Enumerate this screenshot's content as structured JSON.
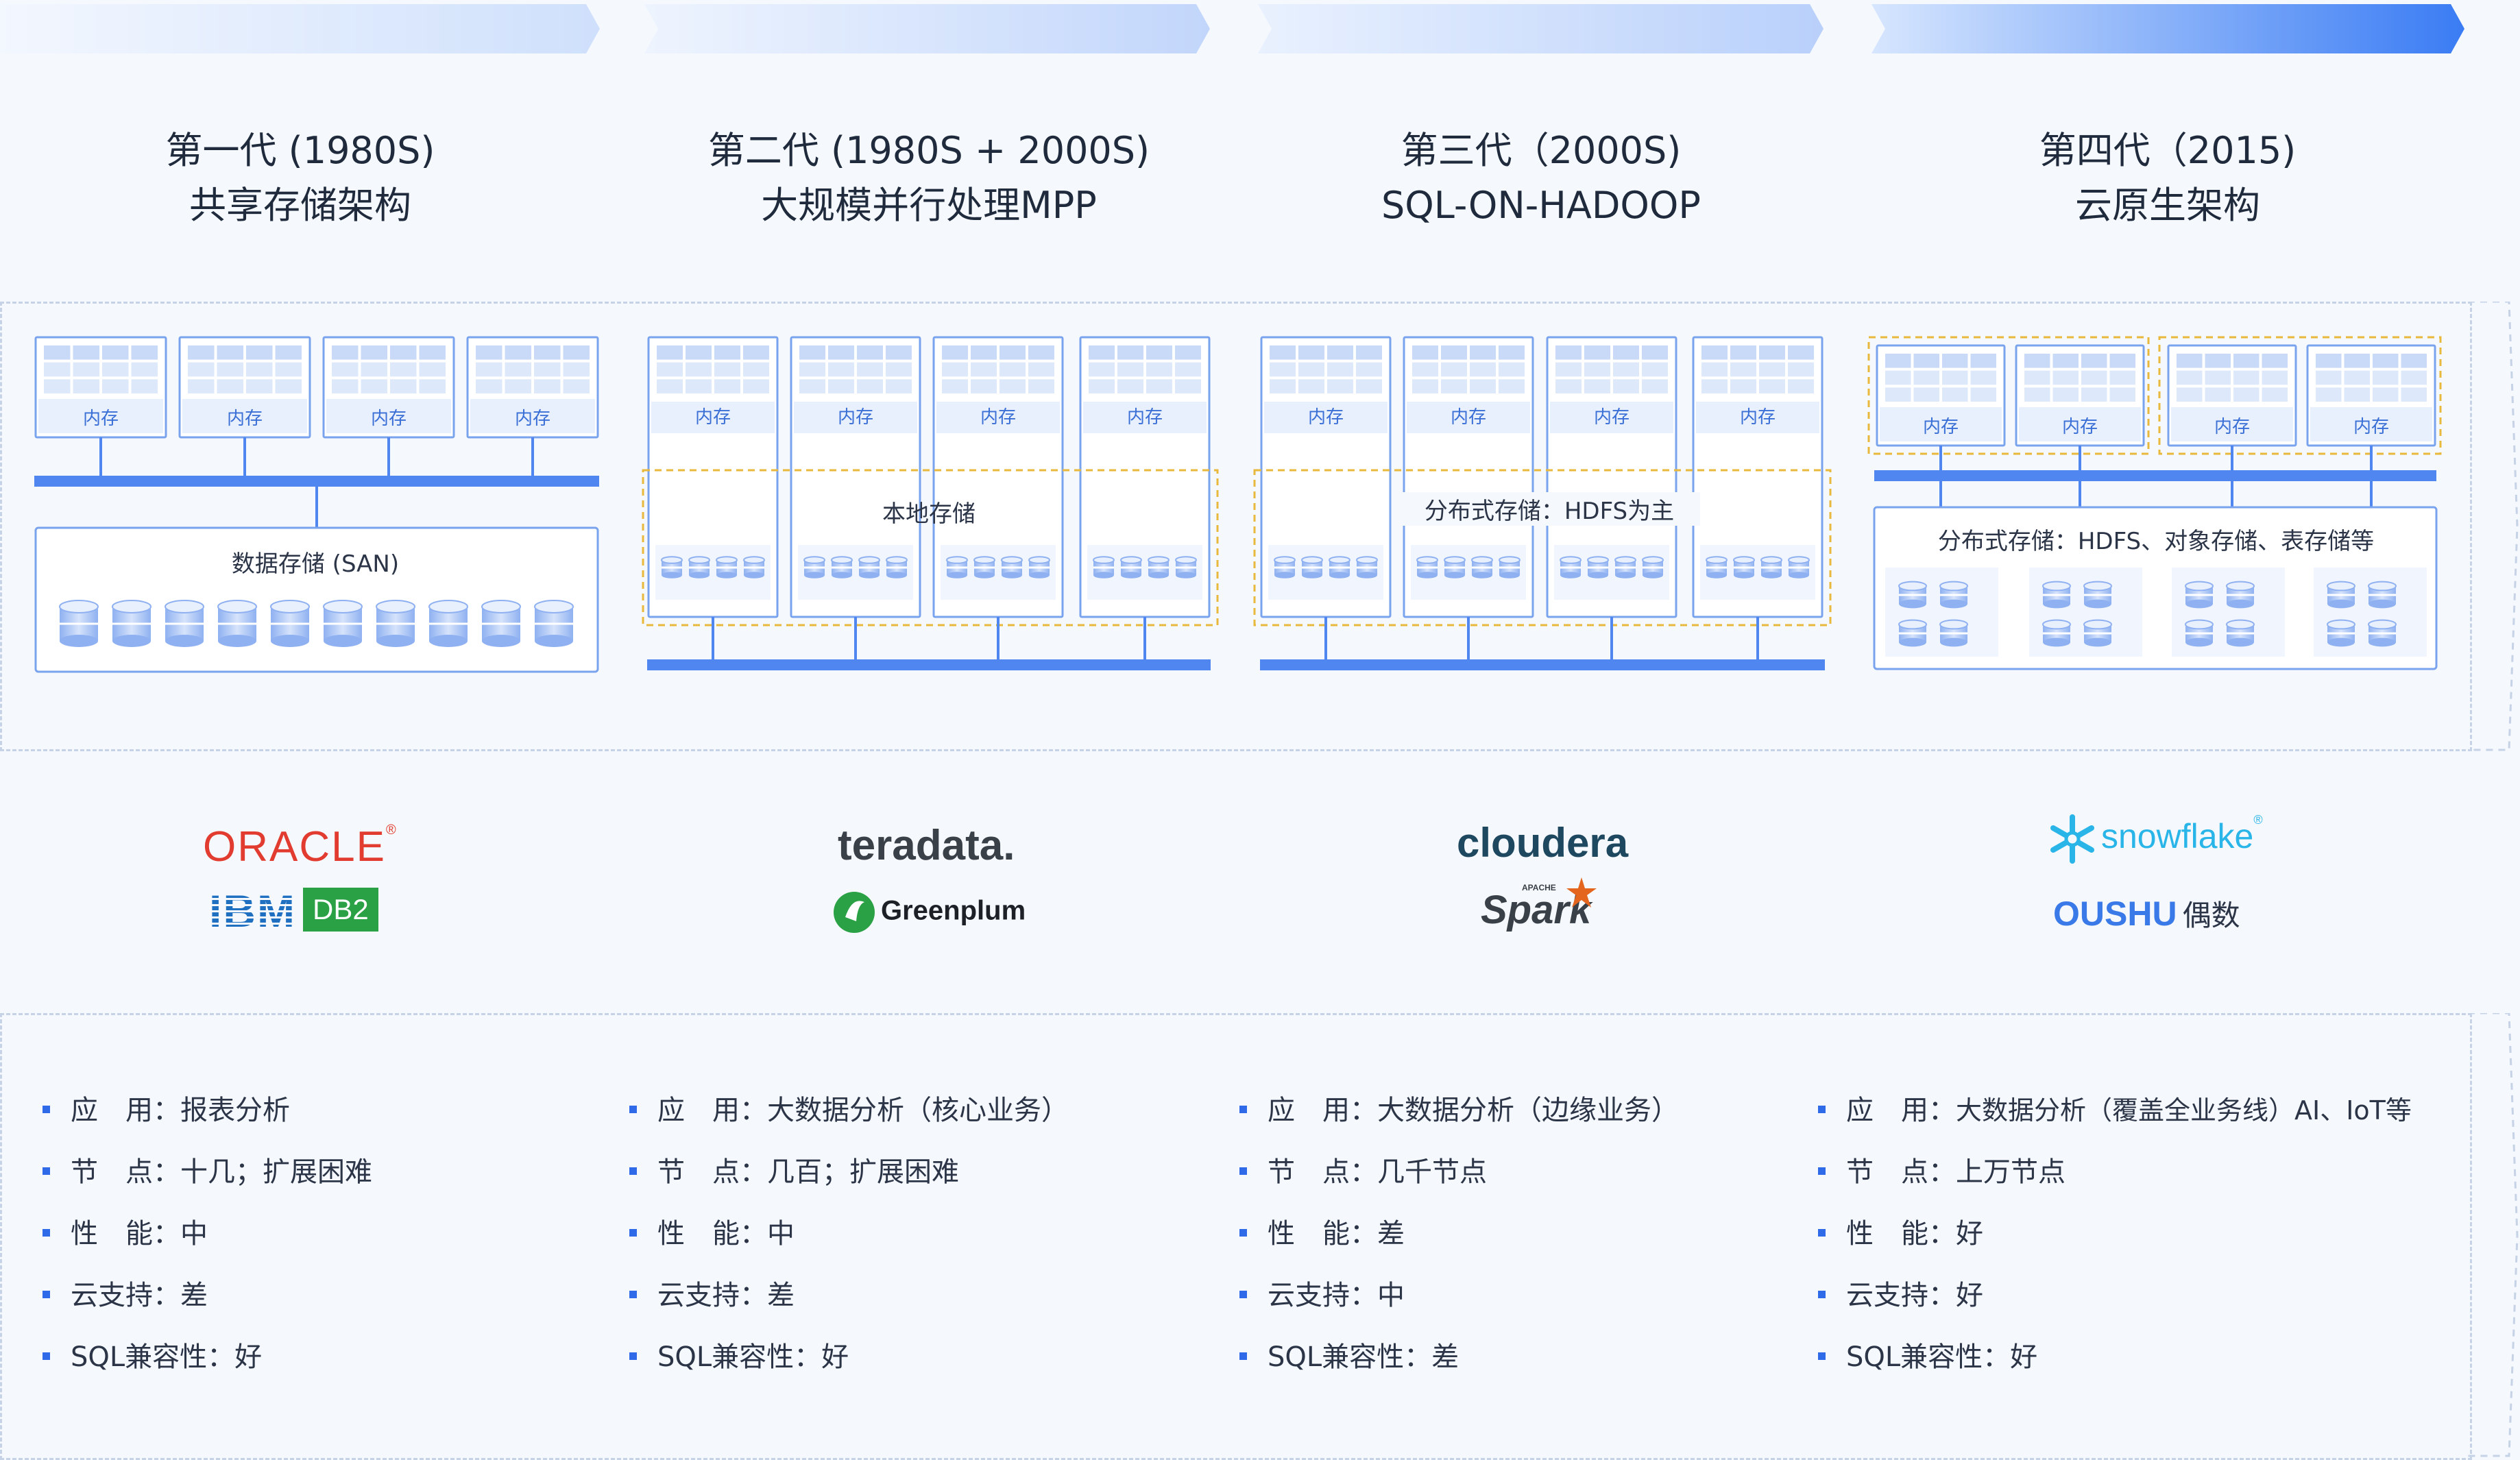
{
  "colors": {
    "accent": "#3370ff",
    "bar": "#4f86ef",
    "node_border": "#7aa3ee",
    "dashed": "#e8b93c",
    "text": "#1f2b3d",
    "oracle": "#e23b2f",
    "ibm": "#1f70c1",
    "db2": "#2aa144",
    "teradata": "#3a4048",
    "cloudera": "#1e4860",
    "spark": "#e3651e",
    "snowflake": "#29b5e8",
    "oushu": "#3a79e8"
  },
  "generations": [
    {
      "title1": "第一代 (1980S)",
      "title2": "共享存储架构"
    },
    {
      "title1": "第二代 (1980S + 2000S)",
      "title2": "大规模并行处理MPP"
    },
    {
      "title1": "第三代（2000S)",
      "title2": "SQL-ON-HADOOP"
    },
    {
      "title1": "第四代（2015)",
      "title2": "云原生架构"
    }
  ],
  "diagram": {
    "memory_label": "内存",
    "gen1_storage": "数据存储 (SAN)",
    "gen2_storage": "本地存储",
    "gen3_storage": "分布式存储：HDFS为主",
    "gen4_storage": "分布式存储：HDFS、对象存储、表存储等"
  },
  "vendors": {
    "oracle": "ORACLE",
    "oracle_mark": "®",
    "ibm": "IBM",
    "db2": "DB2",
    "teradata": "teradata.",
    "greenplum": "Greenplum",
    "cloudera": "cloudera",
    "apache": "APACHE",
    "spark": "Spark",
    "snowflake": "snowflake",
    "snowflake_mark": "®",
    "oushu": "OUSHU",
    "oushu_cn": "偶数"
  },
  "features": [
    [
      {
        "k": "应　用：",
        "v": "报表分析"
      },
      {
        "k": "节　点：",
        "v": "十几；扩展困难"
      },
      {
        "k": "性　能：",
        "v": "中"
      },
      {
        "k": "云支持：",
        "v": "差"
      },
      {
        "k": "SQL兼容性：",
        "v": "好"
      }
    ],
    [
      {
        "k": "应　用：",
        "v": "大数据分析（核心业务）"
      },
      {
        "k": "节　点：",
        "v": "几百；扩展困难"
      },
      {
        "k": "性　能：",
        "v": "中"
      },
      {
        "k": "云支持：",
        "v": "差"
      },
      {
        "k": "SQL兼容性：",
        "v": "好"
      }
    ],
    [
      {
        "k": "应　用：",
        "v": "大数据分析（边缘业务）"
      },
      {
        "k": "节　点：",
        "v": "几千节点"
      },
      {
        "k": "性　能：",
        "v": "差"
      },
      {
        "k": "云支持：",
        "v": "中"
      },
      {
        "k": "SQL兼容性：",
        "v": "差"
      }
    ],
    [
      {
        "k": "应　用：",
        "v": "大数据分析（覆盖全业务线）AI、IoT等"
      },
      {
        "k": "节　点：",
        "v": "上万节点"
      },
      {
        "k": "性　能：",
        "v": "好"
      },
      {
        "k": "云支持：",
        "v": "好"
      },
      {
        "k": "SQL兼容性：",
        "v": "好"
      }
    ]
  ]
}
